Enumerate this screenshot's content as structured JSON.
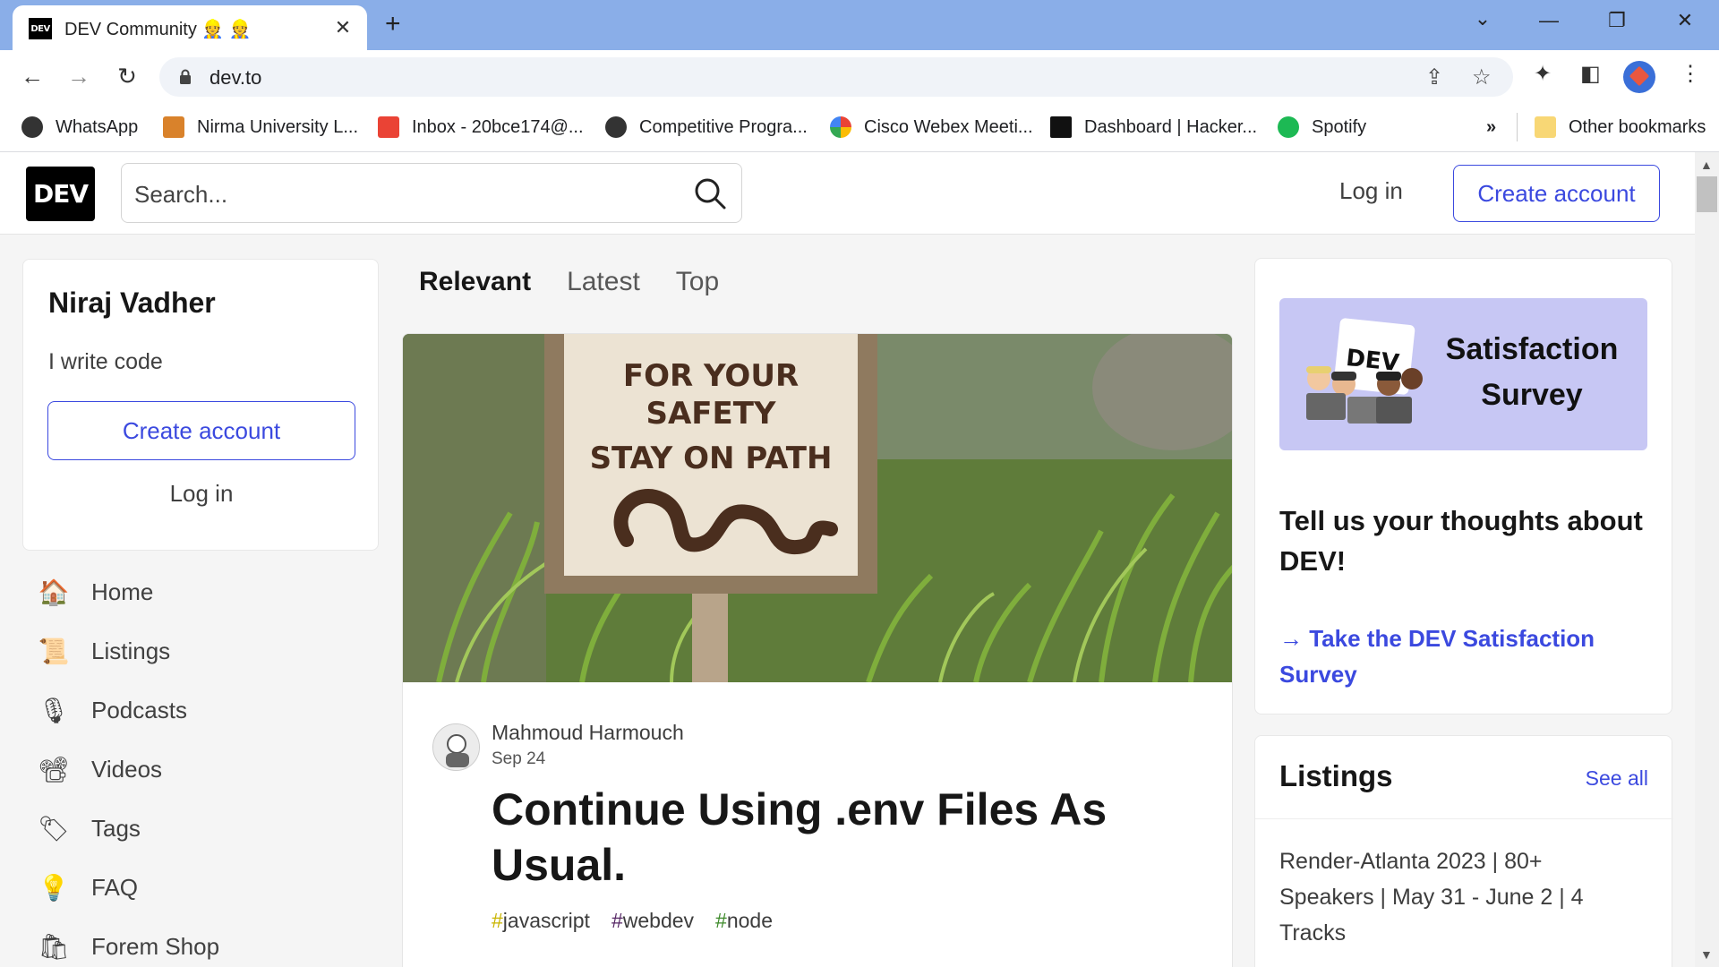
{
  "browser": {
    "tab_title": "DEV Community 👷 👷",
    "tab_favicon_text": "DEV",
    "url": "dev.to",
    "bookmarks": [
      {
        "label": "WhatsApp",
        "icon": "globe-icon",
        "color": "#333333"
      },
      {
        "label": "Nirma University L...",
        "icon": "nirma-icon",
        "color": "#d9822b"
      },
      {
        "label": "Inbox - 20bce174@...",
        "icon": "gmail-icon",
        "color": "#ea4335"
      },
      {
        "label": "Competitive Progra...",
        "icon": "globe-icon",
        "color": "#333333"
      },
      {
        "label": "Cisco Webex Meeti...",
        "icon": "google-icon",
        "color": "#4285f4"
      },
      {
        "label": "Dashboard | Hacker...",
        "icon": "hackerrank-icon",
        "color": "#111111"
      },
      {
        "label": "Spotify",
        "icon": "spotify-icon",
        "color": "#1db954"
      }
    ],
    "overflow_label": "»",
    "other_bookmarks": "Other bookmarks"
  },
  "header": {
    "logo": "DEV",
    "search_placeholder": "Search...",
    "login": "Log in",
    "create_account": "Create account"
  },
  "profile_card": {
    "name": "Niraj Vadher",
    "bio": "I write code",
    "create_account": "Create account",
    "login": "Log in"
  },
  "nav": [
    {
      "label": "Home",
      "icon": "🏠",
      "icon_name": "home-icon"
    },
    {
      "label": "Listings",
      "icon": "📜",
      "icon_name": "listings-icon"
    },
    {
      "label": "Podcasts",
      "icon": "🎙",
      "icon_name": "microphone-icon"
    },
    {
      "label": "Videos",
      "icon": "📽",
      "icon_name": "video-camera-icon"
    },
    {
      "label": "Tags",
      "icon": "🏷",
      "icon_name": "tag-icon"
    },
    {
      "label": "FAQ",
      "icon": "💡",
      "icon_name": "lightbulb-icon"
    },
    {
      "label": "Forem Shop",
      "icon": "🛍",
      "icon_name": "shopping-bag-icon"
    }
  ],
  "feed": {
    "tabs": [
      "Relevant",
      "Latest",
      "Top"
    ],
    "active_tab": "Relevant"
  },
  "article": {
    "sign_lines": [
      "FOR YOUR",
      "SAFETY",
      "STAY ON PATH"
    ],
    "author": "Mahmoud Harmouch",
    "date": "Sep 24",
    "title": "Continue Using .env Files As Usual.",
    "tags": [
      {
        "hash": "#",
        "name": "javascript"
      },
      {
        "hash": "#",
        "name": "webdev"
      },
      {
        "hash": "#",
        "name": "node"
      }
    ]
  },
  "survey": {
    "banner_title": "Satisfaction Survey",
    "banner_badge": "DEV",
    "question": "Tell us your thoughts about DEV!",
    "link": "→ Take the DEV Satisfaction Survey"
  },
  "listings": {
    "title": "Listings",
    "see_all": "See all",
    "first_item": "Render-Atlanta 2023 | 80+ Speakers | May 31 - June 2 | 4 Tracks"
  },
  "colors": {
    "accent": "#3b49df",
    "tabbar": "#8aaee8",
    "background": "#f5f5f5"
  }
}
